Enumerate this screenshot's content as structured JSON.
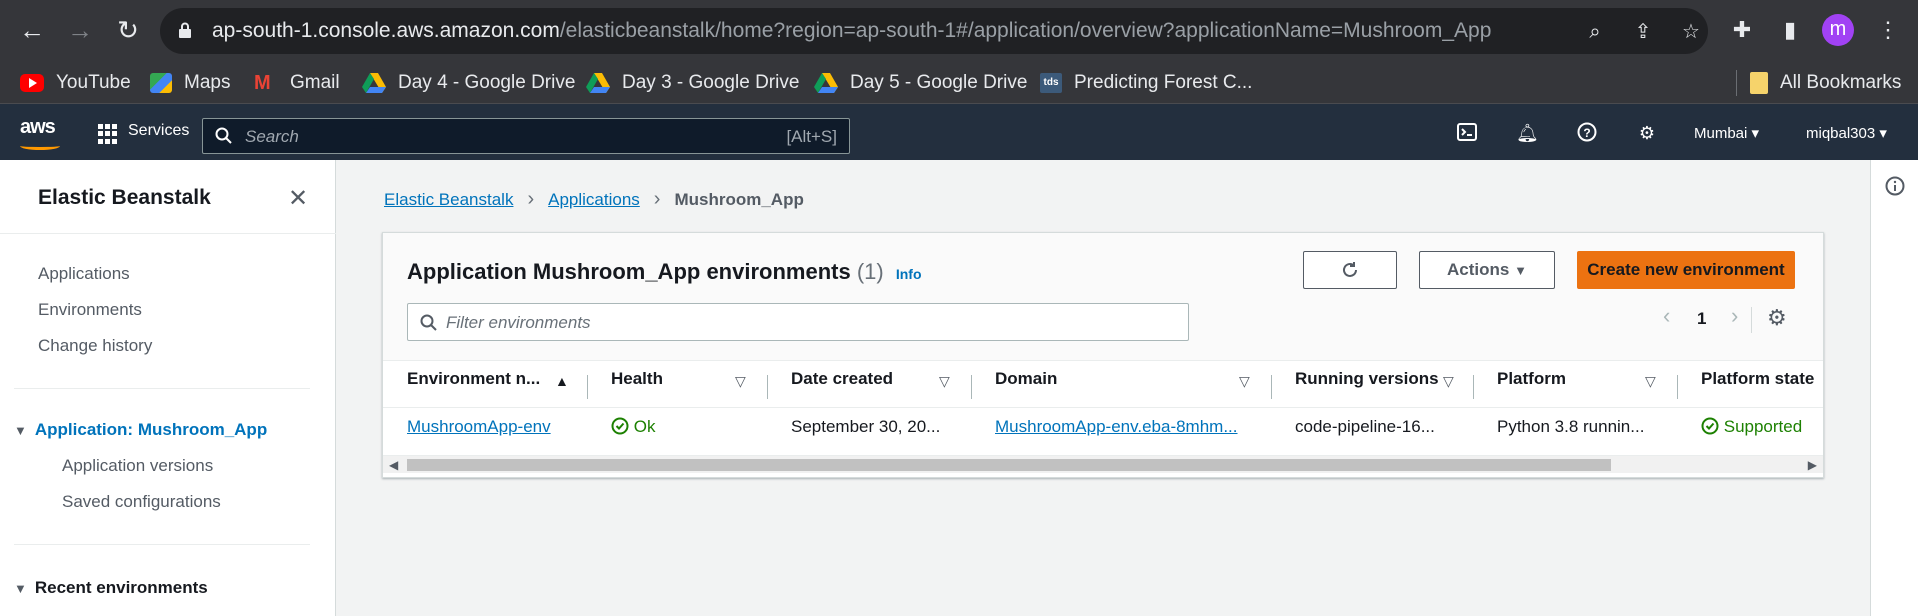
{
  "browser": {
    "url_host": "ap-south-1.console.aws.amazon.com",
    "url_path": "/elasticbeanstalk/home?region=ap-south-1#/application/overview?applicationName=Mushroom_App",
    "profile_initial": "m"
  },
  "bookmarks": [
    {
      "label": "YouTube",
      "icon": "youtube-icon"
    },
    {
      "label": "Maps",
      "icon": "maps-icon"
    },
    {
      "label": "Gmail",
      "icon": "gmail-icon"
    },
    {
      "label": "Day 4 - Google Drive",
      "icon": "drive-icon"
    },
    {
      "label": "Day 3 - Google Drive",
      "icon": "drive-icon"
    },
    {
      "label": "Day 5 - Google Drive",
      "icon": "drive-icon"
    },
    {
      "label": "Predicting Forest C...",
      "icon": "tds-icon"
    }
  ],
  "bookmarks_all": "All Bookmarks",
  "aws": {
    "logo": "aws",
    "services": "Services",
    "search_placeholder": "Search",
    "search_shortcut": "[Alt+S]",
    "region": "Mumbai",
    "user": "miqbal303"
  },
  "sidebar": {
    "title": "Elastic Beanstalk",
    "items": [
      "Applications",
      "Environments",
      "Change history"
    ],
    "app_section": "Application: Mushroom_App",
    "app_items": [
      "Application versions",
      "Saved configurations"
    ],
    "recent": "Recent environments"
  },
  "breadcrumb": {
    "root": "Elastic Beanstalk",
    "apps": "Applications",
    "current": "Mushroom_App"
  },
  "panel": {
    "title": "Application Mushroom_App environments",
    "count": "(1)",
    "info": "Info",
    "actions": "Actions",
    "create": "Create new environment",
    "filter_placeholder": "Filter environments",
    "page": "1"
  },
  "table": {
    "columns": [
      "Environment n...",
      "Health",
      "Date created",
      "Domain",
      "Running versions",
      "Platform",
      "Platform state"
    ],
    "rows": [
      {
        "name": "MushroomApp-env",
        "health": "Ok",
        "date": "September 30, 20...",
        "domain": "MushroomApp-env.eba-8mhm...",
        "version": "code-pipeline-16...",
        "platform": "Python 3.8 runnin...",
        "state": "Supported"
      }
    ]
  },
  "colors": {
    "aws_nav": "#232f3e",
    "primary": "#ec7211",
    "link": "#0073bb",
    "success": "#1d8102"
  }
}
